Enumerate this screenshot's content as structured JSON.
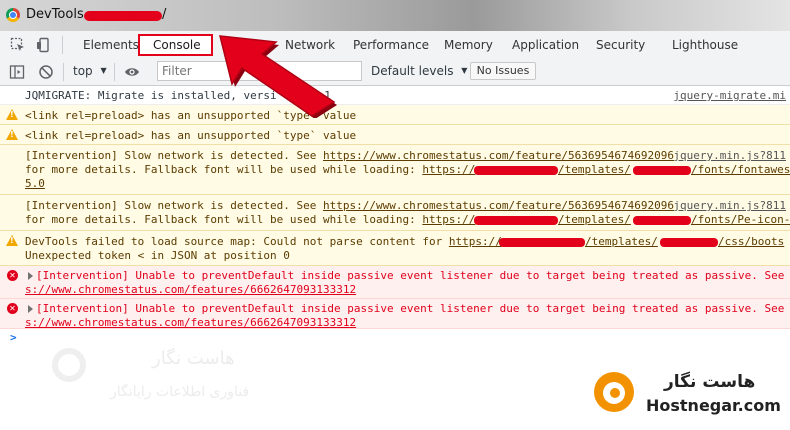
{
  "window": {
    "title": "DevTools - ",
    "title_suffix": "/"
  },
  "tabs": {
    "elements": "Elements",
    "console": "Console",
    "network": "Network",
    "performance": "Performance",
    "memory": "Memory",
    "application": "Application",
    "security": "Security",
    "lighthouse": "Lighthouse"
  },
  "toolbar": {
    "context": "top",
    "filter_placeholder": "Filter",
    "levels": "Default levels",
    "issues": "No Issues"
  },
  "messages": {
    "m1": {
      "text": "JQMIGRATE: Migrate is installed, versi",
      "tail": "4.1",
      "source": "jquery-migrate.mi"
    },
    "m2": {
      "text": "<link rel=preload> has an unsupported `type` value"
    },
    "m3": {
      "text": "<link rel=preload> has an unsupported `type` value"
    },
    "m4": {
      "l1_a": "[Intervention] Slow network is detected. See ",
      "l1_link": "https://www.chromestatus.com/feature/5636954674692096",
      "source": "jquery.min.js?811",
      "l2_a": "for more details. Fallback font will be used while loading: ",
      "l2_link1": "https://",
      "l2_link2": "/templates/",
      "l2_link3": "/fonts/fontawes",
      "l3": "5.0"
    },
    "m5": {
      "l1_a": "[Intervention] Slow network is detected. See ",
      "l1_link": "https://www.chromestatus.com/feature/5636954674692096",
      "source": "jquery.min.js?811",
      "l2_a": "for more details. Fallback font will be used while loading: ",
      "l2_link1": "https://",
      "l2_link2": "/templates/",
      "l2_link3": "/fonts/Pe-icon-"
    },
    "m6": {
      "l1_a": "DevTools failed to load source map: Could not parse content for ",
      "l1_link1": "https://",
      "l1_link2": "/templates/",
      "l1_link3": "/css/boots",
      "l2": "Unexpected token < in JSON at position 0"
    },
    "m7": {
      "l1": "[Intervention] Unable to preventDefault inside passive event listener due to target being treated as passive. See",
      "l2": "s://www.chromestatus.com/features/6662647093133312"
    },
    "m8": {
      "l1": "[Intervention] Unable to preventDefault inside passive event listener due to target being treated as passive. See",
      "l2": "s://www.chromestatus.com/features/6662647093133312"
    }
  },
  "prompt": ">",
  "watermark": {
    "fa_1": "هاست نگار",
    "fa_2": "فناوری اطلاعات رایانگار"
  },
  "brand": {
    "name_fa": "هاست نگار",
    "name_en": "Hostnegar.com"
  },
  "colors": {
    "highlight": "#e3001b",
    "arrow": "#e3001b",
    "brand": "#f39200",
    "warning": "#f2a600",
    "error": "#e0001b"
  }
}
